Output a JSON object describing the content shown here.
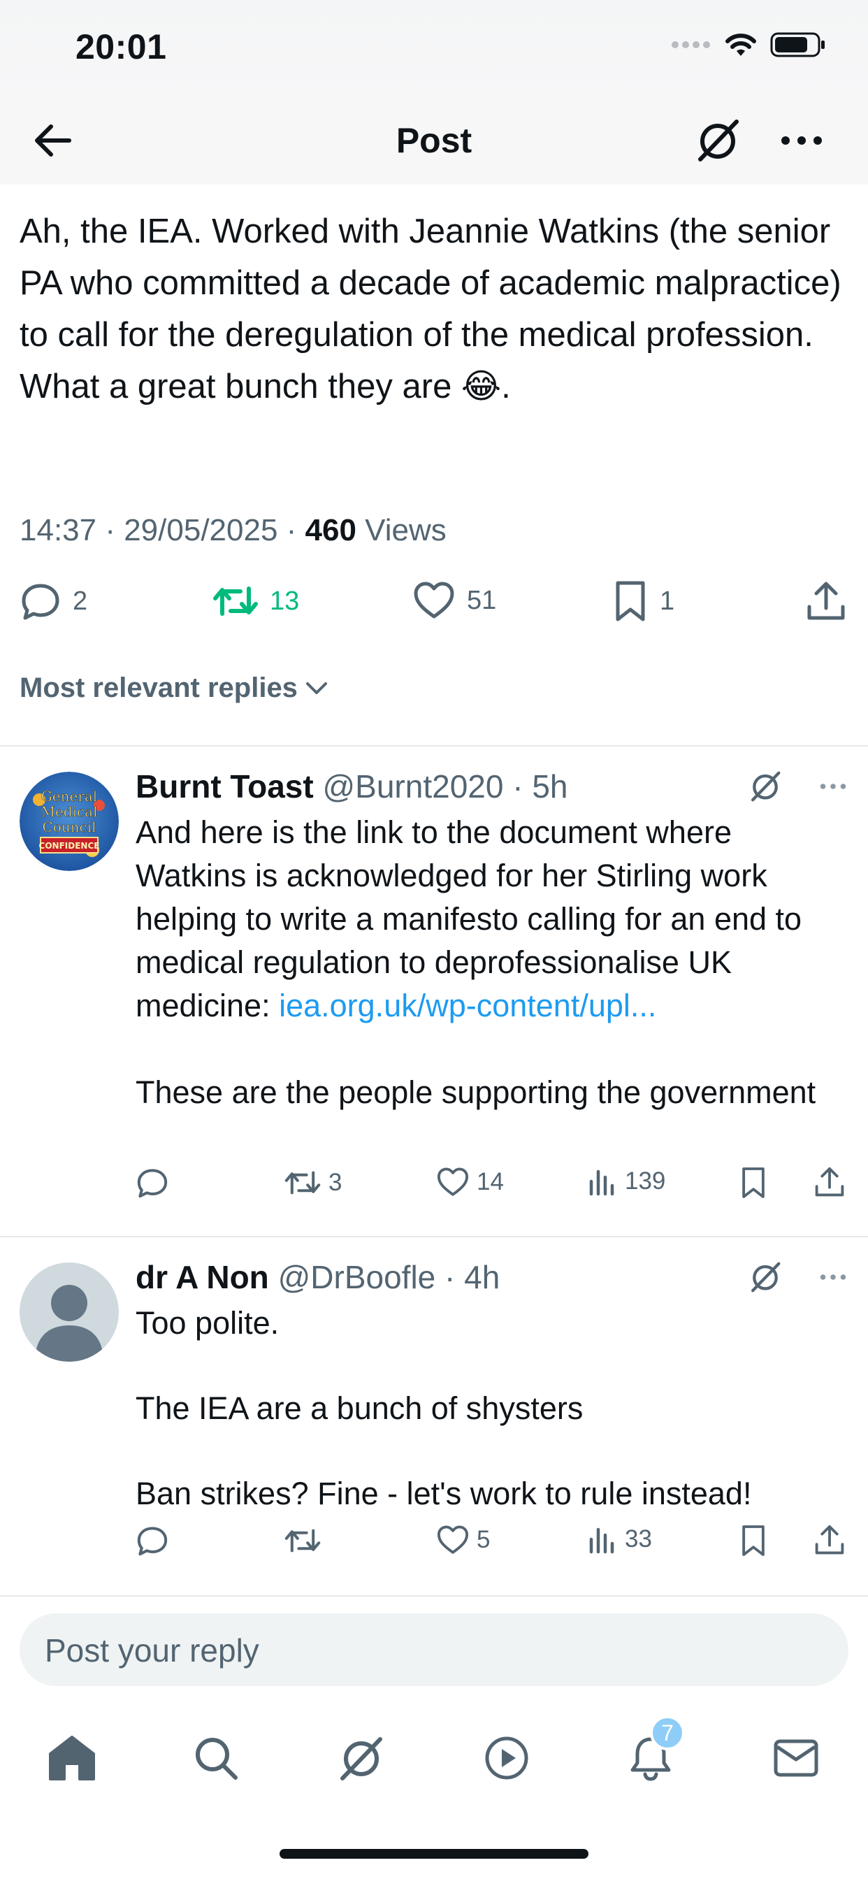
{
  "status_bar": {
    "time": "20:01"
  },
  "header": {
    "title": "Post"
  },
  "tweet": {
    "text": "Ah, the IEA. Worked with Jeannie Watkins (the senior PA who committed a decade of academic malpractice) to call for the deregulation of the medical profession. What a great bunch they are 😂.",
    "time": "14:37 · 29/05/2025 · ",
    "views_count": "460",
    "views_label": " Views",
    "actions": {
      "replies": "2",
      "reposts": "13",
      "likes": "51",
      "bookmarks": "1"
    }
  },
  "sort": {
    "label": "Most relevant replies"
  },
  "replies": [
    {
      "name": "Burnt Toast",
      "handle": "@Burnt2020",
      "time": " · 5h",
      "text_before_link": "And here is the link to the document where Watkins is acknowledged for her Stirling work helping to write a manifesto calling for an end to medical regulation to deprofessionalise UK medicine: ",
      "link": "iea.org.uk/wp-content/upl...",
      "text_after_link": "\n\nThese are the people supporting the government",
      "actions": {
        "replies": "",
        "reposts": "3",
        "likes": "14",
        "views": "139"
      },
      "avatar_text": "General Medical Council"
    },
    {
      "name": "dr A Non",
      "handle": "@DrBoofle",
      "time": " · 4h",
      "text": "Too polite.\n\nThe IEA are a bunch of shysters\n\nBan strikes? Fine - let's work to rule instead!",
      "actions": {
        "replies": "",
        "reposts": "",
        "likes": "5",
        "views": "33"
      }
    }
  ],
  "composer": {
    "placeholder": "Post your reply"
  },
  "tab_bar": {
    "notifications_badge": "7"
  },
  "colors": {
    "accent": "#1d9bf0",
    "repost_active": "#00ba7c",
    "secondary_text": "#536471"
  }
}
